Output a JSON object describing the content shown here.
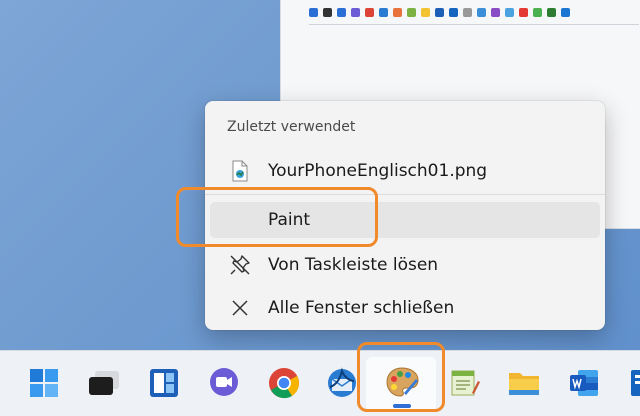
{
  "jumplist": {
    "header": "Zuletzt verwendet",
    "recent_file": "YourPhoneEnglisch01.png",
    "app_item": "Paint",
    "unpin": "Von Taskleiste lösen",
    "close_all": "Alle Fenster schließen"
  },
  "taskbar": {
    "icons": [
      "windows-start-icon",
      "task-view-icon",
      "widgets-icon",
      "teams-chat-icon",
      "chrome-icon",
      "thunderbird-icon",
      "paint-icon",
      "notepad-icon",
      "file-explorer-icon",
      "word-icon",
      "app-icon"
    ],
    "active_app": "paint-icon"
  },
  "colors": {
    "highlight": "#f08a2b",
    "accent": "#2f6fd6",
    "menu_bg": "#f3f3f3",
    "desktop": "#6f9bd0"
  }
}
